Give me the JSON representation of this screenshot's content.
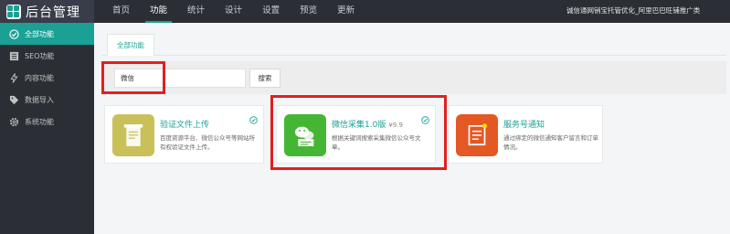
{
  "app": {
    "title": "后台管理"
  },
  "topnav": {
    "items": [
      "首页",
      "功能",
      "统计",
      "设计",
      "设置",
      "预览",
      "更新"
    ],
    "active_index": 1,
    "right_text": "诚信通网销宝托管优化_阿里巴巴旺铺推广类"
  },
  "sidebar": {
    "items": [
      {
        "label": "全部功能",
        "icon": "check-circle-icon",
        "active": true
      },
      {
        "label": "SEO功能",
        "icon": "list-icon",
        "active": false
      },
      {
        "label": "内容功能",
        "icon": "lightning-icon",
        "active": false
      },
      {
        "label": "数据导入",
        "icon": "tag-icon",
        "active": false
      },
      {
        "label": "系统功能",
        "icon": "gear-icon",
        "active": false
      }
    ]
  },
  "main": {
    "tab_label": "全部功能",
    "search": {
      "value": "微信",
      "button_label": "搜索"
    },
    "cards": [
      {
        "title": "验证文件上传",
        "price": "",
        "desc": "百度资源平台、微信公众号等网站所有权验证文件上传。",
        "icon": "document-upload-icon",
        "icon_color": "#c9c05a",
        "checked": true
      },
      {
        "title": "微信采集1.0版",
        "price": "¥9.9",
        "desc": "根据关键词搜索采集微信公众号文章。",
        "icon": "wechat-icon",
        "icon_color": "#45b634",
        "checked": true
      },
      {
        "title": "服务号通知",
        "price": "",
        "desc": "通过绑定的微信通知客户留言和订单情况。",
        "icon": "notice-icon",
        "icon_color": "#e45824",
        "checked": false
      }
    ]
  },
  "colors": {
    "accent": "#1aa094",
    "highlight": "#e02020",
    "dark": "#2b2f35"
  }
}
